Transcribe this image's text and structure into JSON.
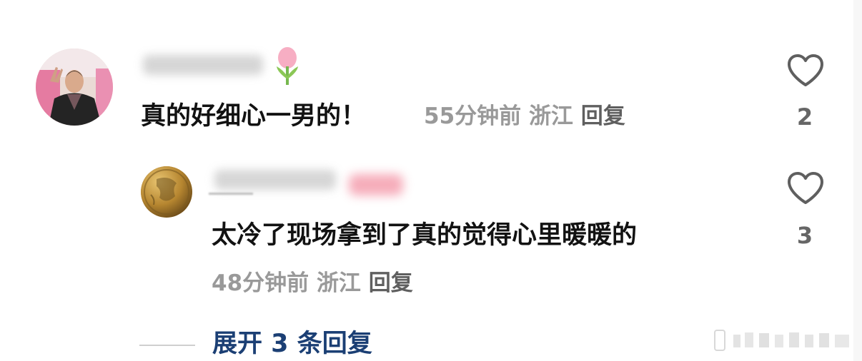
{
  "comments": [
    {
      "text": "真的好细心一男的！",
      "time": "55分钟前",
      "location": "浙江",
      "reply_label": "回复",
      "like_count": "2"
    },
    {
      "text": "太冷了现场拿到了真的觉得心里暖暖的",
      "time": "48分钟前",
      "location": "浙江",
      "reply_label": "回复",
      "like_count": "3"
    }
  ],
  "expand_replies_label": "展开 3 条回复",
  "icons": {
    "like": "heart-outline-icon"
  }
}
